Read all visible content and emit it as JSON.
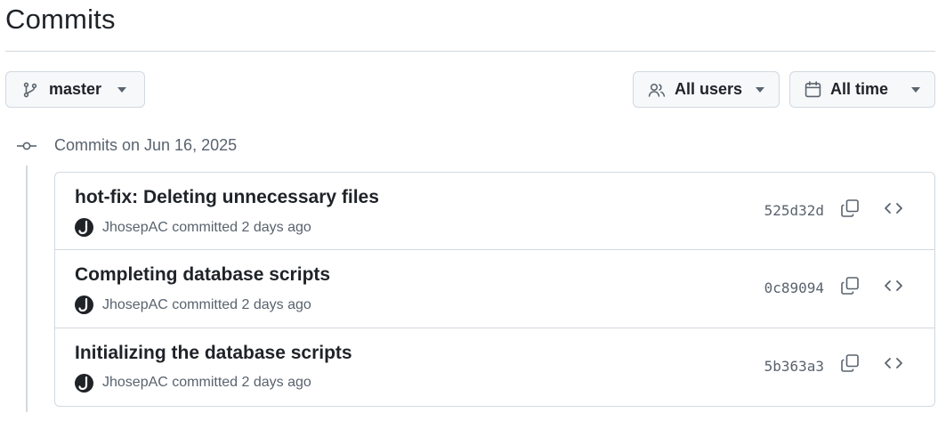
{
  "page": {
    "title": "Commits"
  },
  "filters": {
    "branch": {
      "label": "master",
      "icon": "git-branch-icon"
    },
    "users": {
      "label": "All users",
      "icon": "people-icon"
    },
    "time": {
      "label": "All time",
      "icon": "calendar-icon"
    }
  },
  "timeline": {
    "group_label": "Commits on Jun 16, 2025",
    "commits": [
      {
        "message": "hot-fix: Deleting unnecessary files",
        "author": "JhosepAC",
        "action": "committed",
        "time": "2 days ago",
        "sha": "525d32d"
      },
      {
        "message": "Completing database scripts",
        "author": "JhosepAC",
        "action": "committed",
        "time": "2 days ago",
        "sha": "0c89094"
      },
      {
        "message": "Initializing the database scripts",
        "author": "JhosepAC",
        "action": "committed",
        "time": "2 days ago",
        "sha": "5b363a3"
      }
    ]
  },
  "colors": {
    "text": "#1f2328",
    "muted": "#59636e",
    "border": "#d1d9e0",
    "button_bg": "#f6f8fa"
  }
}
